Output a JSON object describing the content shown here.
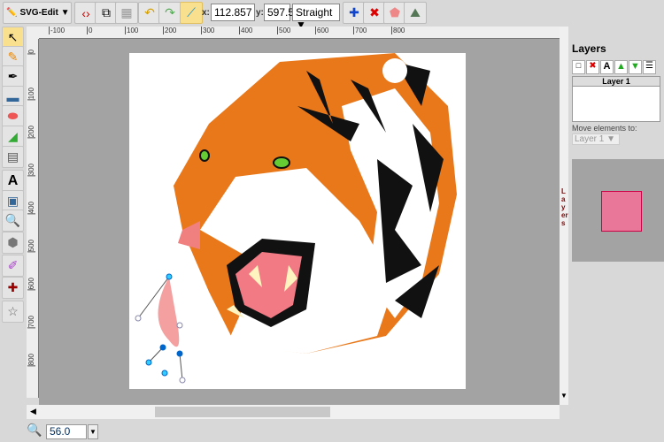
{
  "toolbar": {
    "menu_label": "SVG-Edit",
    "x_label": "x:",
    "x_value": "112.857",
    "y_label": "y:",
    "y_value": "597.5",
    "segment_type": "Straight",
    "icons": [
      "svg-edit-logo",
      "source-icon",
      "wireframe-icon",
      "grid-icon",
      "undo-icon",
      "redo-icon",
      "node-edit-icon",
      "add-node-icon",
      "delete-node-icon",
      "close-path-icon",
      "clone-node-icon"
    ]
  },
  "tools": [
    "select",
    "pencil",
    "pen",
    "rectangle",
    "ellipse",
    "path",
    "shapelib",
    "text",
    "image",
    "zoom",
    "polygon",
    "eyedropper",
    "shape-library",
    "star"
  ],
  "ruler": {
    "h_labels": [
      "-100",
      "0",
      "100",
      "200",
      "300",
      "400",
      "500",
      "600",
      "700",
      "800"
    ],
    "v_labels": [
      "0",
      "100",
      "200",
      "300",
      "400",
      "500",
      "600",
      "700",
      "800"
    ]
  },
  "layers": {
    "title": "Layers",
    "side_tab": "Layers",
    "column": "Layer 1",
    "move_label": "Move elements to:",
    "move_value": "Layer 1"
  },
  "zoom": {
    "value": "56.0"
  },
  "colors": {
    "accent": "#f8e08e",
    "orange": "#e8781a",
    "canvas": "#a3a3a3"
  }
}
